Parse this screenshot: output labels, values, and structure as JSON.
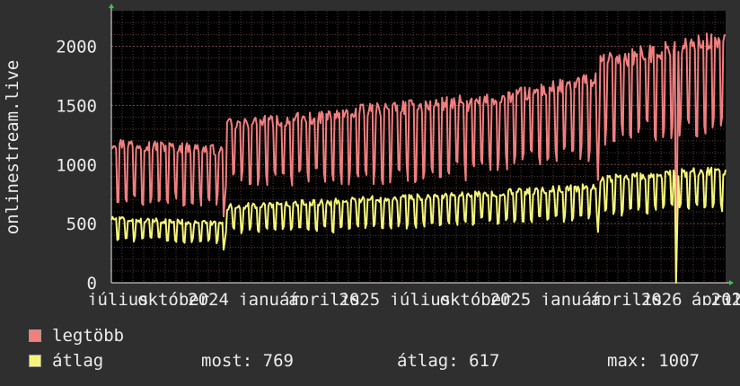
{
  "chart_data": {
    "type": "line",
    "ylabel": "onlinestream.live",
    "ylim": [
      0,
      2300
    ],
    "yticks": [
      0,
      500,
      1000,
      1500,
      2000
    ],
    "xticks": [
      "július",
      "október",
      "2024",
      "január",
      "április",
      "2025",
      "július",
      "október",
      "2025",
      "január",
      "április",
      "2026",
      "április",
      "202"
    ],
    "grid": true,
    "colors": {
      "background": "#000000",
      "frame": "#2f2f2f",
      "grid": "#5a3a3a",
      "text": "#ececec",
      "max": "#f07f80",
      "avg": "#f4f47a"
    },
    "series": [
      {
        "name": "legtöbb",
        "color": "#f07f80",
        "segments": [
          {
            "start": 0,
            "end": 95,
            "base": [
              1180,
              1120
            ],
            "low": [
              730,
              700
            ]
          },
          {
            "start": 96,
            "end": 200,
            "base": [
              1330,
              1420
            ],
            "low": [
              880,
              900
            ]
          },
          {
            "start": 201,
            "end": 300,
            "base": [
              1440,
              1530
            ],
            "low": [
              900,
              950
            ]
          },
          {
            "start": 301,
            "end": 412,
            "base": [
              1500,
              1720
            ],
            "low": [
              1000,
              1100
            ]
          },
          {
            "start": 413,
            "end": 520,
            "base": [
              1860,
              2060
            ],
            "low": [
              1250,
              1350
            ]
          }
        ],
        "dips": [
          {
            "at": 95,
            "value": 560
          },
          {
            "at": 412,
            "value": 870
          },
          {
            "at": 478,
            "value": 30
          }
        ]
      },
      {
        "name": "átlag",
        "color": "#f4f47a",
        "segments": [
          {
            "start": 0,
            "end": 95,
            "base": [
              540,
              500
            ],
            "low": [
              370,
              350
            ]
          },
          {
            "start": 96,
            "end": 200,
            "base": [
              640,
              690
            ],
            "low": [
              440,
              460
            ]
          },
          {
            "start": 201,
            "end": 300,
            "base": [
              700,
              740
            ],
            "low": [
              480,
              500
            ]
          },
          {
            "start": 301,
            "end": 412,
            "base": [
              740,
              810
            ],
            "low": [
              520,
              560
            ]
          },
          {
            "start": 413,
            "end": 520,
            "base": [
              880,
              950
            ],
            "low": [
              600,
              650
            ]
          }
        ],
        "dips": [
          {
            "at": 95,
            "value": 280
          },
          {
            "at": 412,
            "value": 430
          },
          {
            "at": 478,
            "value": 0
          }
        ]
      }
    ]
  },
  "legend": {
    "max_label": "legtöbb",
    "avg_label": "átlag",
    "now": "most: 769",
    "avg": "átlag: 617",
    "max": "max: 1007"
  }
}
